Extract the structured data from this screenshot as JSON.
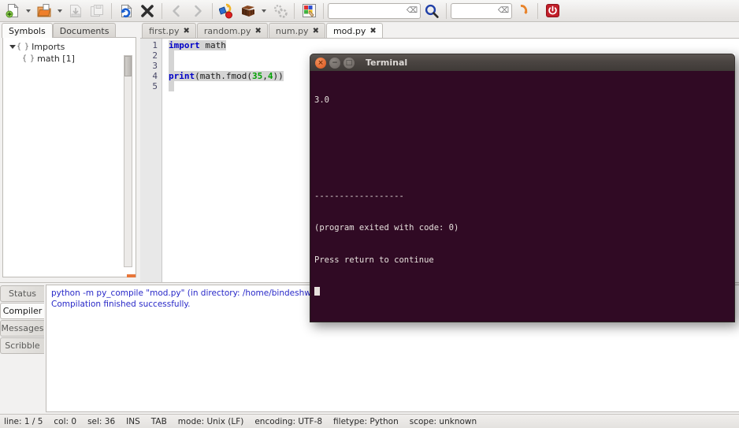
{
  "toolbar": {
    "buttons": [
      {
        "name": "new-file-icon",
        "label": "New"
      },
      {
        "name": "new-file-dropdown-icon",
        "label": ""
      },
      {
        "name": "open-file-icon",
        "label": "Open"
      },
      {
        "name": "open-file-dropdown-icon",
        "label": ""
      },
      {
        "name": "save-icon",
        "label": "Save"
      },
      {
        "name": "save-all-icon",
        "label": "Save All"
      },
      {
        "name": "revert-icon",
        "label": "Revert"
      },
      {
        "name": "close-icon",
        "label": "Close"
      },
      {
        "name": "navigate-back-icon",
        "label": "Back"
      },
      {
        "name": "navigate-forward-icon",
        "label": "Forward"
      },
      {
        "name": "compile-icon",
        "label": "Compile"
      },
      {
        "name": "build-icon",
        "label": "Build"
      },
      {
        "name": "build-dropdown-icon",
        "label": ""
      },
      {
        "name": "build-options-icon",
        "label": "Build Options"
      },
      {
        "name": "color-chooser-icon",
        "label": "Color Chooser"
      }
    ],
    "search_value": "",
    "search_placeholder": "",
    "goto_value": "",
    "goto_placeholder": "",
    "search_icon": "search-icon",
    "goto_icon": "goto-line-icon",
    "quit_icon": "quit-icon"
  },
  "sidebar": {
    "tabs": [
      {
        "label": "Symbols",
        "active": true
      },
      {
        "label": "Documents",
        "active": false
      }
    ],
    "tree": [
      {
        "label": "Imports",
        "depth": 0,
        "expanded": true
      },
      {
        "label": "math [1]",
        "depth": 1,
        "expanded": false
      }
    ]
  },
  "editor": {
    "tabs": [
      {
        "label": "first.py",
        "active": false
      },
      {
        "label": "random.py",
        "active": false
      },
      {
        "label": "num.py",
        "active": false
      },
      {
        "label": "mod.py",
        "active": true
      }
    ],
    "close_glyph": "✖",
    "line_numbers": [
      "1",
      "2",
      "3",
      "4",
      "5"
    ],
    "lines": [
      {
        "n": "1",
        "tokens": [
          {
            "t": "import",
            "c": "kw",
            "sel": true
          },
          {
            "t": " ",
            "c": "plain",
            "sel": true
          },
          {
            "t": "math",
            "c": "plain",
            "sel": true
          }
        ]
      },
      {
        "n": "2",
        "tokens": []
      },
      {
        "n": "3",
        "tokens": []
      },
      {
        "n": "4",
        "tokens": [
          {
            "t": "print",
            "c": "kw",
            "sel": true
          },
          {
            "t": "(math.fmod(",
            "c": "plain",
            "sel": true
          },
          {
            "t": "35",
            "c": "num",
            "sel": true
          },
          {
            "t": ",",
            "c": "plain",
            "sel": true
          },
          {
            "t": "4",
            "c": "num",
            "sel": true
          },
          {
            "t": "))",
            "c": "plain",
            "sel": true
          }
        ]
      },
      {
        "n": "5",
        "tokens": []
      }
    ]
  },
  "bottom_panel": {
    "tabs": [
      {
        "label": "Status",
        "active": false
      },
      {
        "label": "Compiler",
        "active": true
      },
      {
        "label": "Messages",
        "active": false
      },
      {
        "label": "Scribble",
        "active": false
      }
    ],
    "lines": [
      "python -m py_compile \"mod.py\" (in directory: /home/bindeshwar/Desktop/p",
      "Compilation finished successfully."
    ]
  },
  "statusbar": {
    "items": [
      "line: 1 / 5",
      "col: 0",
      "sel: 36",
      "INS",
      "TAB",
      "mode: Unix (LF)",
      "encoding: UTF-8",
      "filetype: Python",
      "scope: unknown"
    ]
  },
  "terminal": {
    "title": "Terminal",
    "close_glyph": "×",
    "minimize_glyph": "−",
    "maximize_glyph": "□",
    "lines": [
      "3.0",
      "",
      "",
      "------------------",
      "(program exited with code: 0)",
      "Press return to continue"
    ]
  },
  "colors": {
    "terminal_bg": "#300a24",
    "terminal_fg": "#e6e0dc",
    "keyword": "#0000c8",
    "number": "#00a000",
    "compiler_text": "#2828c8",
    "accent_orange": "#e8763a"
  }
}
